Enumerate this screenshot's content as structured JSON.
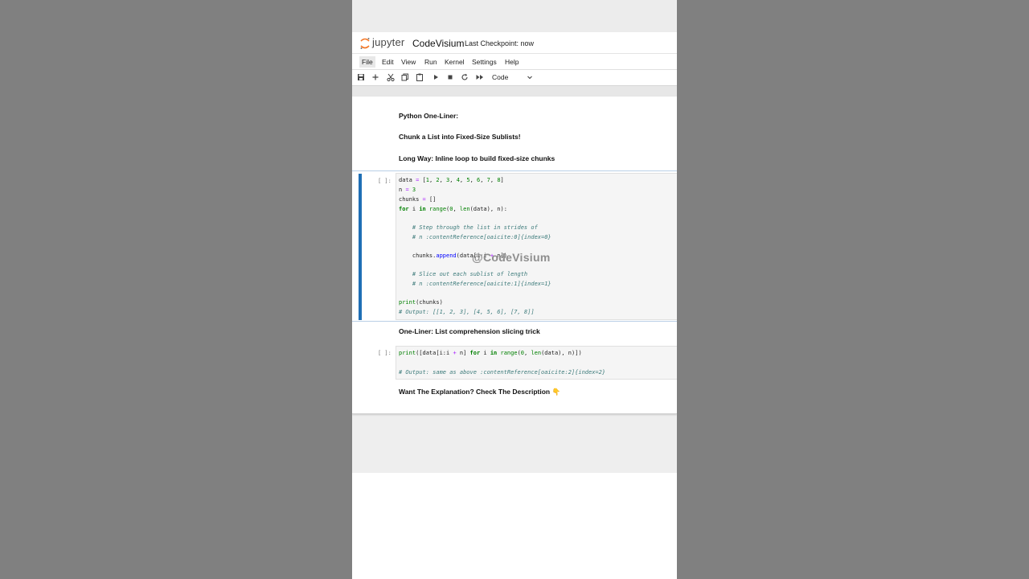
{
  "header": {
    "logo_text": "jupyter",
    "notebook_name": "CodeVisium",
    "checkpoint": "Last Checkpoint: now"
  },
  "menu": [
    "File",
    "Edit",
    "View",
    "Run",
    "Kernel",
    "Settings",
    "Help"
  ],
  "toolbar": {
    "icons": [
      "save-icon",
      "add-icon",
      "cut-icon",
      "copy-icon",
      "paste-icon",
      "run-icon",
      "stop-icon",
      "restart-icon",
      "fast-forward-icon"
    ],
    "cell_type": "Code"
  },
  "cells": {
    "md1": {
      "line1": "Python One-Liner:",
      "line2": "Chunk a List into Fixed-Size Sublists!",
      "line3": "Long Way: Inline loop to build fixed-size chunks"
    },
    "code1": {
      "prompt": "[ ]:",
      "lines": [
        "data = [1, 2, 3, 4, 5, 6, 7, 8]",
        "n = 3",
        "chunks = []",
        "for i in range(0, len(data), n):",
        "",
        "    # Step through the list in strides of",
        "    # n :contentReference[oaicite:0]{index=0}",
        "",
        "    chunks.append(data[i:i + n])",
        "",
        "    # Slice out each sublist of length",
        "    # n :contentReference[oaicite:1]{index=1}",
        "",
        "print(chunks)",
        "# Output: [[1, 2, 3], [4, 5, 6], [7, 8]]"
      ]
    },
    "md2": {
      "text": "One-Liner: List comprehension slicing trick"
    },
    "code2": {
      "prompt": "[ ]:",
      "lines": [
        "print([data[i:i + n] for i in range(0, len(data), n)])",
        "",
        "# Output: same as above :contentReference[oaicite:2]{index=2}"
      ]
    },
    "md3": {
      "text": "Want The Explanation? Check The Description 👇"
    }
  },
  "watermark": "@CodeVisium",
  "colors": {
    "selected_bar": "#1f6fb5",
    "keyword": "#008000",
    "comment": "#3d7b7b",
    "operator": "#aa22ff"
  }
}
